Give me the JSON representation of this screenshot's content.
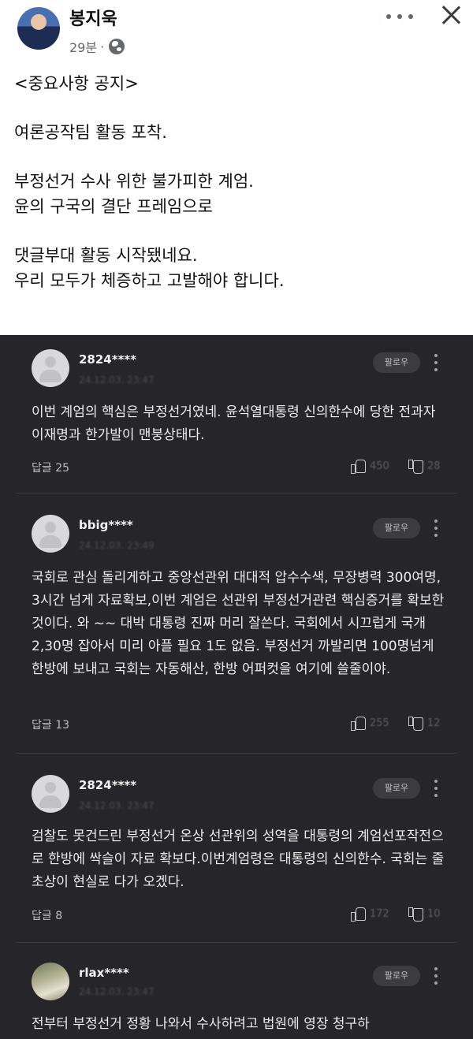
{
  "post": {
    "author": "봉지욱",
    "time": "29분",
    "separator": "·",
    "lines": [
      "<중요사항 공지>",
      "",
      "여론공작팀 활동 포착.",
      "",
      "부정선거 수사 위한 불가피한 계엄.",
      "윤의 구국의 결단 프레임으로",
      "",
      "댓글부대 활동 시작됐네요.",
      "우리 모두가 체증하고 고발해야 합니다."
    ]
  },
  "comments": [
    {
      "name": "2824****",
      "date": "24.12.03. 23:47",
      "follow": "팔로우",
      "text": "이번 계엄의 핵심은 부정선거였네. 윤석열대통령 신의한수에 당한 전과자 이재명과 한가발이 맨붕상태다.",
      "reply": "답글 25",
      "likes": "450",
      "dislikes": "28"
    },
    {
      "name": "bbig****",
      "date": "24.12.03. 23:49",
      "follow": "팔로우",
      "text": "국회로 관심 돌리게하고 중앙선관위 대대적 압수수색, 무장병력 300여명, 3시간 넘게 자료확보,이번 계엄은 선관위 부정선거관련 핵심증거를 확보한것이다. 와 ~~ 대박 대통령 진짜 머리 잘쓴다. 국회에서 시끄럽게 국개 2,30명 잡아서 미리 아플 필요 1도 없음. 부정선거 까발리면 100명넘게 한방에 보내고 국회는 자동해산, 한방 어퍼컷을 여기에 쓸줄이야.",
      "reply": "답글 13",
      "likes": "255",
      "dislikes": "12"
    },
    {
      "name": "2824****",
      "date": "24.12.03. 23:47",
      "follow": "팔로우",
      "text": "검찰도 못건드린 부정선거 온상 선관위의 성역을 대통령의 계엄선포작전으로 한방에 싹슬이 자료 확보다.이번계엄령은 대통령의 신의한수. 국회는 줄초상이 현실로 다가 오겠다.",
      "reply": "답글 8",
      "likes": "172",
      "dislikes": "10"
    },
    {
      "name": "rlax****",
      "date": "24.12.03. 23:47",
      "follow": "팔로우",
      "text": "전부터 부정선거 정황 나와서 수사하려고 법원에 영장 청구하"
    }
  ],
  "icons": {
    "more": "more-horizontal-icon",
    "close": "close-icon",
    "audience": "globe-icon",
    "like": "thumb-up-icon",
    "dislike": "thumb-down-icon",
    "comment_menu": "kebab-menu-icon"
  },
  "colors": {
    "panel_bg": "#26262a",
    "text_dark": "#111111",
    "meta_gray": "#65676b"
  }
}
